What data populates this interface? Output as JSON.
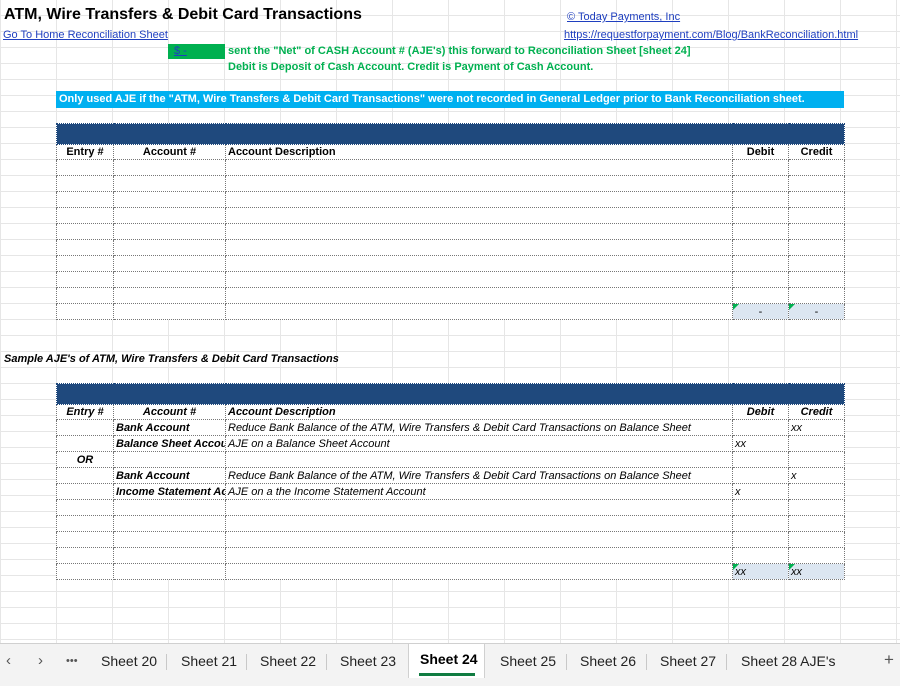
{
  "header": {
    "title": "ATM, Wire Transfers & Debit Card Transactions",
    "home_link": "Go To Home Reconciliation Sheet",
    "company_link": "© Today Payments, Inc",
    "url_link": "https://requestforpayment.com/Blog/BankReconciliation.html"
  },
  "cash_cell": "$         -",
  "notes": {
    "line1": "sent the \"Net\" of CASH Account # (AJE's) this forward to Reconciliation Sheet [sheet 24]",
    "line2": "Debit is Deposit of Cash Account.  Credit is Payment of Cash Account."
  },
  "banner": "Only used AJE if the \"ATM, Wire Transfers & Debit Card Transactions\" were not recorded in General Ledger prior to Bank Reconciliation sheet.",
  "table1": {
    "headers": {
      "entry": "Entry #",
      "account": "Account #",
      "description": "Account Description",
      "debit": "Debit",
      "credit": "Credit"
    },
    "totals": {
      "debit": "-",
      "credit": "-"
    }
  },
  "sample_title": "Sample AJE's of ATM, Wire Transfers & Debit Card Transactions",
  "table2": {
    "headers": {
      "entry": "Entry #",
      "account": "Account #",
      "description": "Account Description",
      "debit": "Debit",
      "credit": "Credit"
    },
    "rows": [
      {
        "entry": "",
        "account": "Bank Account",
        "description": "Reduce Bank Balance of the ATM, Wire Transfers & Debit Card Transactions on Balance Sheet",
        "debit": "",
        "credit": "xx"
      },
      {
        "entry": "",
        "account": "Balance Sheet Account",
        "description": "AJE on a Balance Sheet Account",
        "debit": "xx",
        "credit": ""
      },
      {
        "entry": "OR",
        "account": "",
        "description": "",
        "debit": "",
        "credit": ""
      },
      {
        "entry": "",
        "account": "Bank Account",
        "description": "Reduce Bank Balance of the ATM, Wire Transfers & Debit Card Transactions on Balance Sheet",
        "debit": "",
        "credit": "x"
      },
      {
        "entry": "",
        "account": "Income Statement Account",
        "description": "AJE on a the Income Statement Account",
        "debit": "x",
        "credit": ""
      }
    ],
    "totals": {
      "debit": "xx",
      "credit": "xx"
    }
  },
  "tabs": {
    "items": [
      "Sheet 20",
      "Sheet 21",
      "Sheet 22",
      "Sheet 23",
      "Sheet 24",
      "Sheet 25",
      "Sheet 26",
      "Sheet 27",
      "Sheet 28 AJE's"
    ],
    "active": "Sheet 24",
    "more": "•••",
    "prev": "‹",
    "next": "›",
    "add": "+"
  }
}
